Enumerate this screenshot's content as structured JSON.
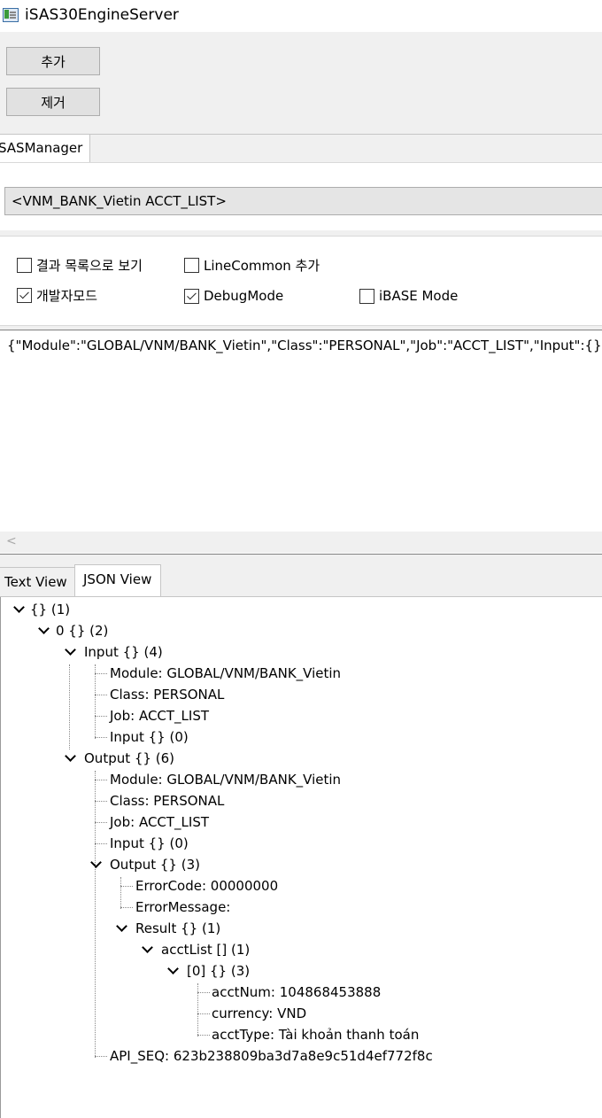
{
  "window": {
    "title": "iSAS30EngineServer"
  },
  "toolbar": {
    "add_label": "추가",
    "remove_label": "제거"
  },
  "top_tabs": [
    {
      "label": "SASManager"
    }
  ],
  "target_combo": {
    "value": "<VNM_BANK_Vietin ACCT_LIST>"
  },
  "options": [
    {
      "label": "결과 목록으로 보기",
      "checked": false
    },
    {
      "label": "LineCommon 추가",
      "checked": false
    },
    {
      "label": "개발자모드",
      "checked": true
    },
    {
      "label": "DebugMode",
      "checked": true
    },
    {
      "label": "iBASE Mode",
      "checked": false
    }
  ],
  "request": {
    "text": "{\"Module\":\"GLOBAL/VNM/BANK_Vietin\",\"Class\":\"PERSONAL\",\"Job\":\"ACCT_LIST\",\"Input\":{}}"
  },
  "result_tabs": [
    {
      "label": "Text View"
    },
    {
      "label": "JSON View"
    }
  ],
  "tree": [
    {
      "label": "{} (1)",
      "expanded": true
    },
    {
      "label": "0 {} (2)",
      "expanded": true
    },
    {
      "label": "Input {} (4)",
      "expanded": true
    },
    {
      "label": "Module: GLOBAL/VNM/BANK_Vietin"
    },
    {
      "label": "Class: PERSONAL"
    },
    {
      "label": "Job: ACCT_LIST"
    },
    {
      "label": "Input {} (0)"
    },
    {
      "label": "Output {} (6)",
      "expanded": true
    },
    {
      "label": "Module: GLOBAL/VNM/BANK_Vietin"
    },
    {
      "label": "Class: PERSONAL"
    },
    {
      "label": "Job: ACCT_LIST"
    },
    {
      "label": "Input {} (0)"
    },
    {
      "label": "Output {} (3)",
      "expanded": true
    },
    {
      "label": "ErrorCode: 00000000"
    },
    {
      "label": "ErrorMessage:"
    },
    {
      "label": "Result {} (1)",
      "expanded": true
    },
    {
      "label": "acctList [] (1)",
      "expanded": true
    },
    {
      "label": "[0] {} (3)",
      "expanded": true
    },
    {
      "label": "acctNum: 104868453888"
    },
    {
      "label": "currency: VND"
    },
    {
      "label": "acctType: Tài khoản thanh toán"
    },
    {
      "label": "API_SEQ: 623b238809ba3d7a8e9c51d4ef772f8c"
    }
  ]
}
